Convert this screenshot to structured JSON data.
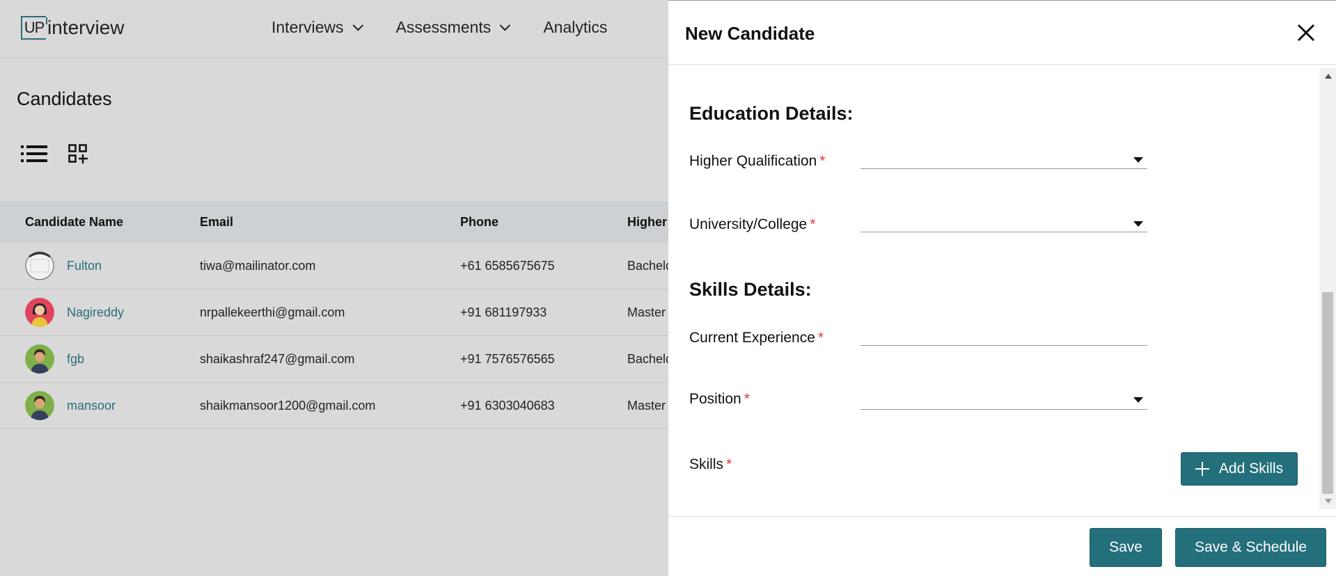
{
  "header": {
    "logo_boxed": "UP",
    "logo_rest": "interview",
    "nav": [
      {
        "label": "Interviews",
        "has_dropdown": true
      },
      {
        "label": "Assessments",
        "has_dropdown": true
      },
      {
        "label": "Analytics",
        "has_dropdown": false
      }
    ]
  },
  "page": {
    "title": "Candidates",
    "view_icons": [
      "list-view-icon",
      "grid-add-view-icon"
    ]
  },
  "table": {
    "columns": [
      "Candidate Name",
      "Email",
      "Phone",
      "Higher"
    ],
    "rows": [
      {
        "name": "Fulton",
        "email": "tiwa@mailinator.com",
        "phone": "+61 6585675675",
        "qualification": "Bachelo"
      },
      {
        "name": "Nagireddy",
        "email": "nrpallekeerthi@gmail.com",
        "phone": "+91 681197933",
        "qualification": "Master"
      },
      {
        "name": "fgb",
        "email": "shaikashraf247@gmail.com",
        "phone": "+91 7576576565",
        "qualification": "Bachelo"
      },
      {
        "name": "mansoor",
        "email": "shaikmansoor1200@gmail.com",
        "phone": "+91 6303040683",
        "qualification": "Master"
      }
    ]
  },
  "drawer": {
    "title": "New Candidate",
    "education_title": "Education Details:",
    "skills_title": "Skills Details:",
    "required_mark": "*",
    "fields": {
      "higher_qualification": "Higher Qualification",
      "university": "University/College",
      "current_experience": "Current Experience",
      "position": "Position",
      "skills": "Skills"
    },
    "add_skills_label": "Add Skills",
    "save_label": "Save",
    "save_schedule_label": "Save & Schedule"
  },
  "colors": {
    "accent": "#236f7b",
    "link": "#2b6e79",
    "required": "#e53935",
    "overlay_bg": "#d9d9d9"
  }
}
